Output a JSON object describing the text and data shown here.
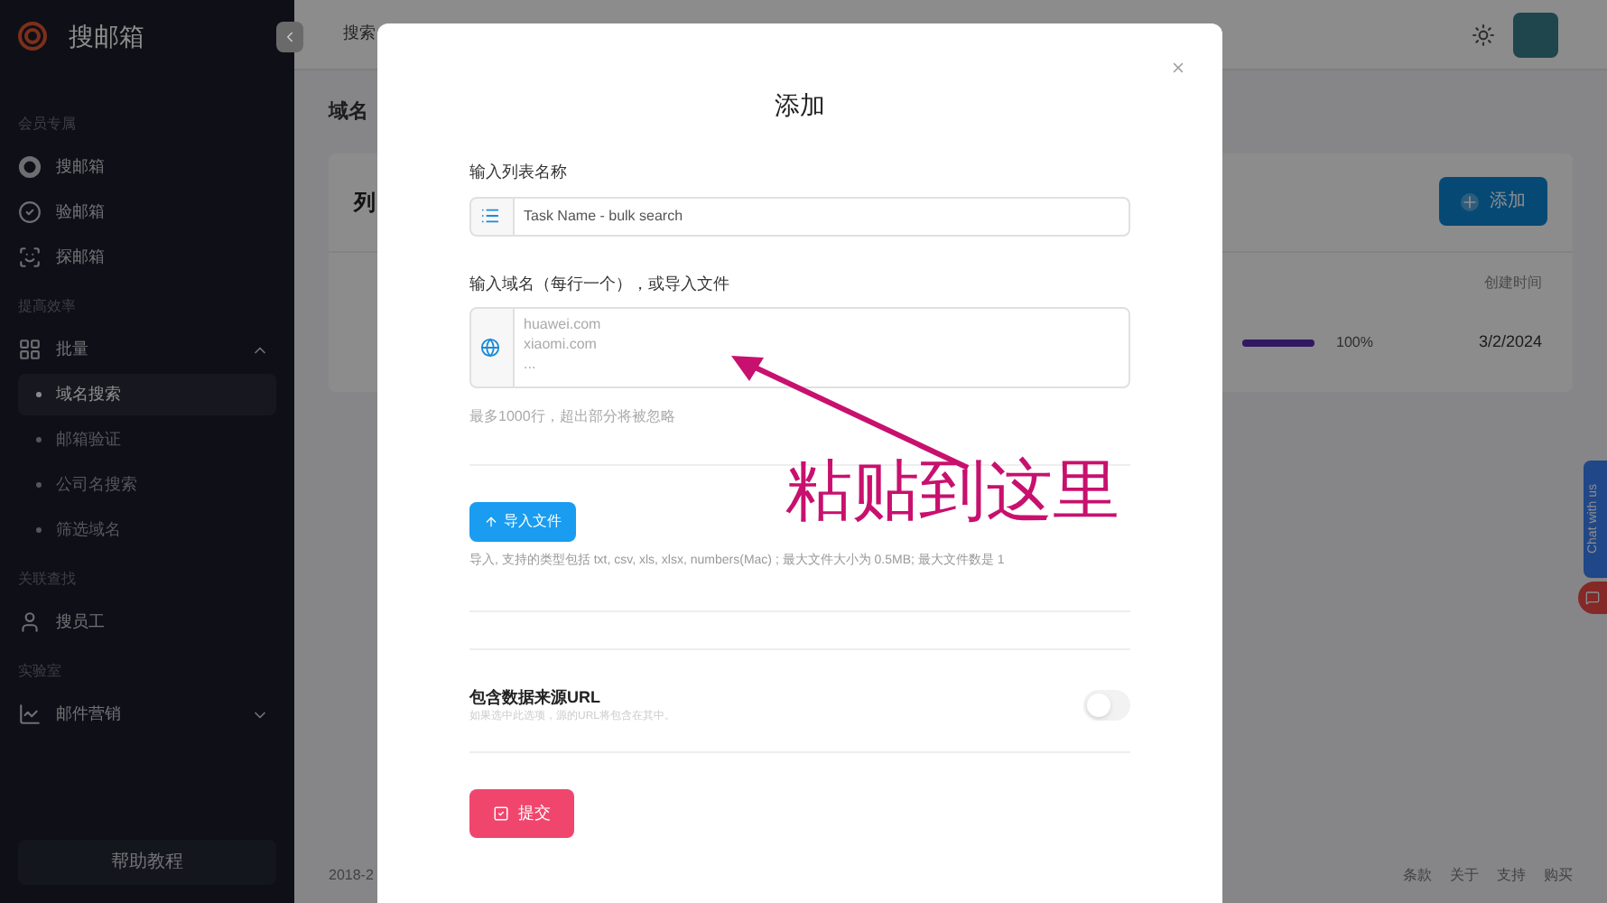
{
  "sidebar": {
    "brand": "搜邮箱",
    "sections": [
      {
        "heading": "会员专属",
        "items": [
          {
            "label": "搜邮箱"
          },
          {
            "label": "验邮箱"
          },
          {
            "label": "探邮箱"
          }
        ]
      },
      {
        "heading": "提高效率",
        "items": [
          {
            "label": "批量",
            "expanded": true,
            "children": [
              {
                "label": "域名搜索",
                "selected": true
              },
              {
                "label": "邮箱验证",
                "selected": false
              },
              {
                "label": "公司名搜索",
                "selected": false
              },
              {
                "label": "筛选域名",
                "selected": false
              }
            ]
          }
        ]
      },
      {
        "heading": "关联查找",
        "items": [
          {
            "label": "搜员工"
          }
        ]
      },
      {
        "heading": "实验室",
        "items": [
          {
            "label": "邮件营销",
            "expanded": false
          }
        ]
      }
    ],
    "help_button": "帮助教程"
  },
  "topbar": {
    "tab": "搜索"
  },
  "page": {
    "breadcrumb": "域名",
    "card_title": "列",
    "add_button": "添加",
    "column_created": "创建时间",
    "row": {
      "progress": {
        "level": 1
      },
      "percent": "100%",
      "created": "3/2/2024"
    },
    "footer": "2018-2",
    "footer_links": [
      "条款",
      "关于",
      "支持",
      "购买"
    ]
  },
  "chat_tab": "Chat with us",
  "modal": {
    "title": "添加",
    "name_label": "输入列表名称",
    "name_placeholder": "Task Name - bulk search",
    "domains_label": "输入域名（每行一个），或导入文件",
    "domains_placeholder": "huawei.com\nxiaomi.com\n...",
    "domains_hint": "最多1000行，超出部分将被忽略",
    "import_button": "导入文件",
    "import_hint": "导入, 支持的类型包括 txt, csv, xls, xlsx, numbers(Mac) ; 最大文件大小为 0.5MB; 最大文件数是 1",
    "source_url": {
      "label": "包含数据来源URL",
      "hint": "如果选中此选项，源的URL将包含在其中。",
      "on": false
    },
    "submit_button": "提交"
  },
  "annotation": {
    "text": "粘贴到这里"
  }
}
